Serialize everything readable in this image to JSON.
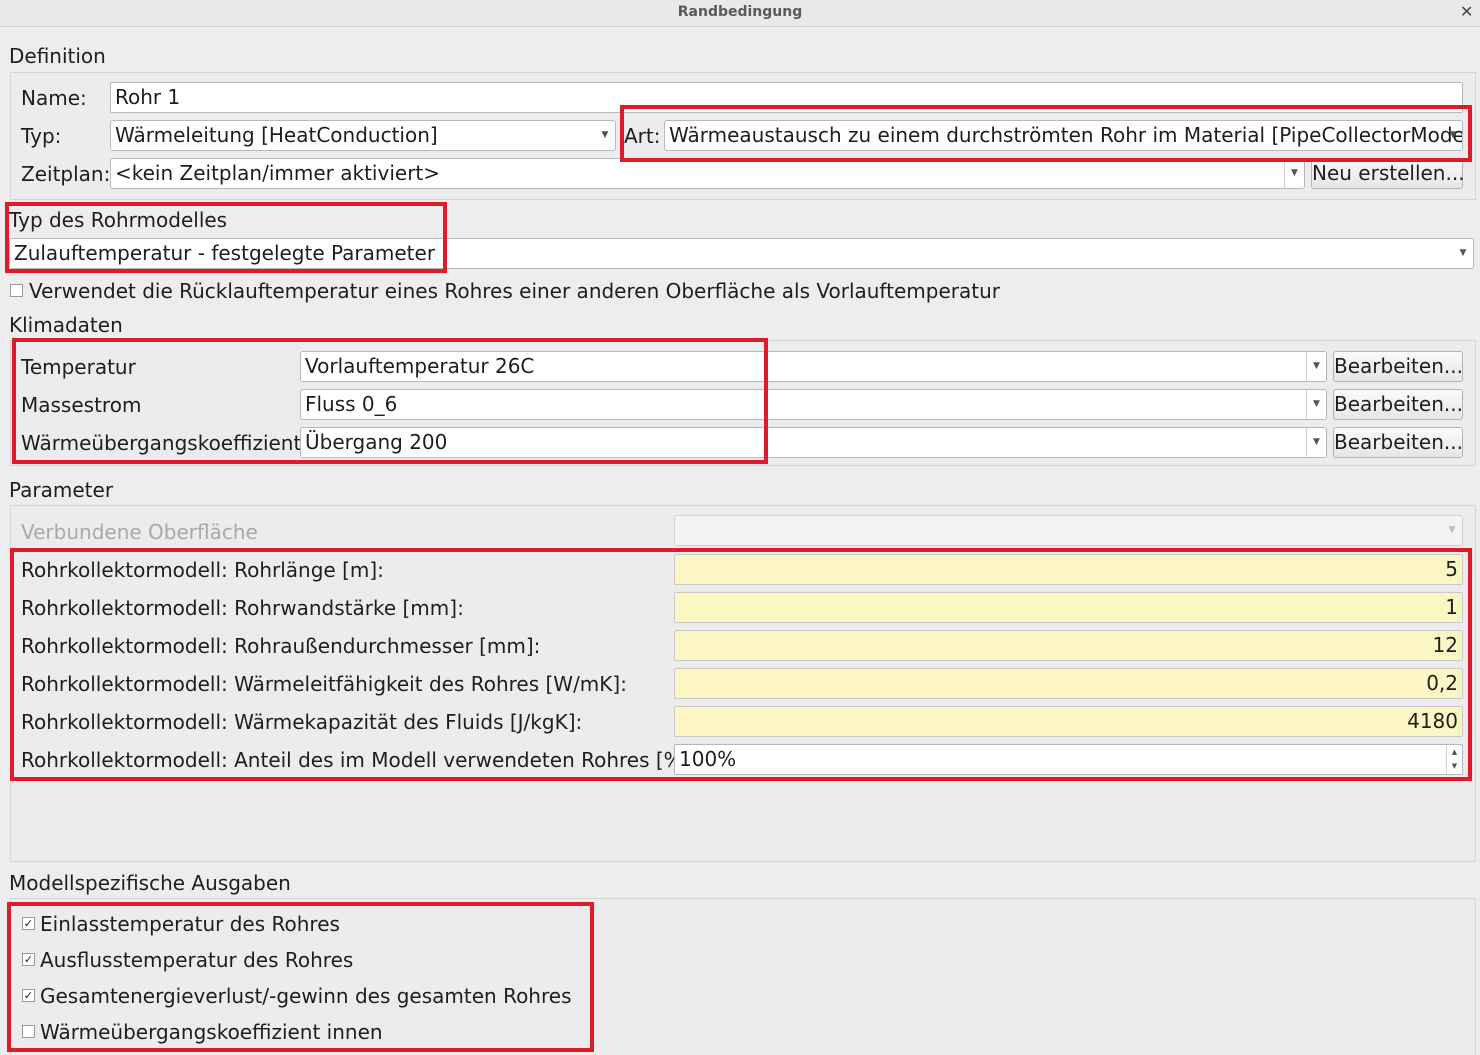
{
  "window": {
    "title": "Randbedingung"
  },
  "definition": {
    "group_title": "Definition",
    "name_label": "Name:",
    "name_value": "Rohr 1",
    "typ_label": "Typ:",
    "typ_value": "Wärmeleitung [HeatConduction]",
    "art_label": "Art:",
    "art_value": "Wärmeaustausch zu einem durchströmten Rohr im Material [PipeCollectorModel]",
    "zeitplan_label": "Zeitplan:",
    "zeitplan_value": "<kein Zeitplan/immer aktiviert>",
    "neu_button": "Neu erstellen..."
  },
  "rohrmodell": {
    "group_title": "Typ des Rohrmodelles",
    "selected": "Zulauftemperatur - festgelegte Parameter"
  },
  "ruecklauf_checkbox": {
    "label": "Verwendet die Rücklauftemperatur eines Rohres einer anderen Oberfläche als Vorlauftemperatur",
    "checked": false
  },
  "klimadaten": {
    "group_title": "Klimadaten",
    "rows": [
      {
        "label": "Temperatur",
        "value": "Vorlauftemperatur 26C",
        "button": "Bearbeiten..."
      },
      {
        "label": "Massestrom",
        "value": "Fluss 0_6",
        "button": "Bearbeiten..."
      },
      {
        "label": "Wärmeübergangskoeffizient",
        "value": "Übergang 200",
        "button": "Bearbeiten..."
      }
    ]
  },
  "parameter": {
    "group_title": "Parameter",
    "verbundene_label": "Verbundene Oberfläche",
    "rows": [
      {
        "label": "Rohrkollektormodell: Rohrlänge [m]:",
        "value": "5"
      },
      {
        "label": "Rohrkollektormodell: Rohrwandstärke [mm]:",
        "value": "1"
      },
      {
        "label": "Rohrkollektormodell: Rohraußendurchmesser [mm]:",
        "value": "12"
      },
      {
        "label": "Rohrkollektormodell: Wärmeleitfähigkeit des Rohres [W/mK]:",
        "value": "0,2"
      },
      {
        "label": "Rohrkollektormodell: Wärmekapazität des Fluids [J/kgK]:",
        "value": "4180"
      }
    ],
    "anteil_label": "Rohrkollektormodell: Anteil des im Modell verwendeten Rohres [%]:",
    "anteil_value": "100%"
  },
  "ausgaben": {
    "group_title": "Modellspezifische Ausgaben",
    "items": [
      {
        "label": "Einlasstemperatur des Rohres",
        "checked": true
      },
      {
        "label": "Ausflusstemperatur des Rohres",
        "checked": true
      },
      {
        "label": "Gesamtenergieverlust/-gewinn des gesamten Rohres",
        "checked": true
      },
      {
        "label": "Wärmeübergangskoeffizient innen",
        "checked": false
      }
    ]
  },
  "colors": {
    "highlight": "#dc1c28",
    "number_field": "#fbf6c4"
  }
}
